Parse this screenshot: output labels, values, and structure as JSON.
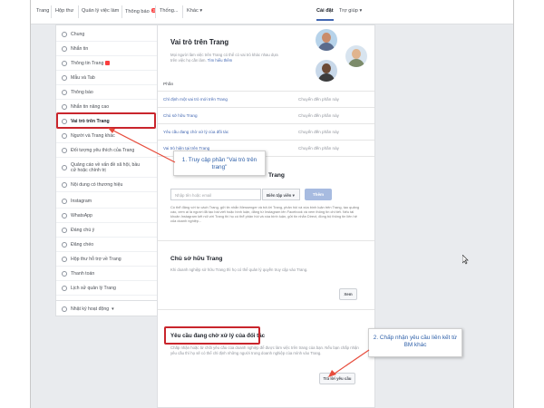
{
  "topbar": {
    "tabs": [
      "Trang",
      "Hộp thư",
      "Quản lý việc làm",
      "Thông báo",
      "Thống...",
      "Khác"
    ],
    "notif_badge": "3",
    "right_tabs": [
      "Cài đặt",
      "Trợ giúp"
    ]
  },
  "sidebar": {
    "items": [
      "Chung",
      "Nhắn tin",
      "Thông tin Trang",
      "Mẫu và Tab",
      "Thông báo",
      "Nhắn tin nâng cao",
      "Vai trò trên Trang",
      "Người và Trang khác",
      "Đối tượng yêu thích của Trang",
      "Quảng cáo về vấn đề xã hội, bầu cử hoặc chính trị",
      "Nội dung có thương hiệu",
      "Instagram",
      "WhatsApp",
      "Đáng chú ý",
      "Đăng chéo",
      "Hộp thư hỗ trợ về Trang",
      "Thanh toán",
      "Lịch sử quản lý Trang"
    ],
    "activity_log": "Nhật ký hoạt động"
  },
  "main": {
    "title": "Vai trò trên Trang",
    "desc": "Mọi người làm việc trên Trang có thể có vai trò khác nhau dựa trên việc họ cần làm.",
    "learn_more": "Tìm hiểu thêm",
    "section_label": "Phần",
    "rows": [
      {
        "label": "Chỉ định một vai trò mới trên Trang",
        "action": "Chuyển đến phần này"
      },
      {
        "label": "Chủ sở hữu Trang",
        "action": "Chuyển đến phần này"
      },
      {
        "label": "Yêu cầu đang chờ xử lý của đối tác",
        "action": "Chuyển đến phần này"
      },
      {
        "label": "Vai trò hiện tại trên Trang",
        "action": "Chuyển đến phần này"
      }
    ],
    "assign_title_partial": "Trang",
    "email_placeholder": "Nhập tên hoặc email",
    "role_select": "Biên tập viên",
    "add_button": "Thêm",
    "assign_desc": "Có thể đăng với tư cách Trang, gửi tin nhắn Messenger và trả lời Trang, phản hồi và xóa bình luận trên Trang, tạo quảng cáo, xem ai là người đã tạo bài viết hoặc bình luận, đăng từ Instagram lên Facebook và xem thông tin chi tiết. Nếu tài khoản Instagram kết nối với Trang thì họ có thể phản hồi và xóa bình luận, gửi tin nhắn Direct, đồng bộ thông tin liên hệ của doanh nghiệp...",
    "owner_title": "Chủ sở hữu Trang",
    "owner_desc": "Khi doanh nghiệp sở hữu Trang thì họ có thể quản lý quyền truy cập vào Trang.",
    "owner_button": "Xem",
    "pending_title": "Yêu cầu đang chờ xử lý của đối tác",
    "pending_desc": "Chấp nhận hoặc từ chối yêu cầu của doanh nghiệp để được làm việc trên trang của bạn. Nếu bạn chấp nhận yêu cầu thì họ sẽ có thể chỉ định những người trong doanh nghiệp của mình vào Trang.",
    "respond_button": "Trả lời yêu cầu"
  },
  "callouts": {
    "step1": "1. Truy cập phần \"Vai trò trên trang\"",
    "step2": "2. Chấp nhận yêu cầu liên kết từ BM khác"
  },
  "colors": {
    "accent": "#4267b2",
    "highlight": "#c9252c",
    "callout_text": "#2d5fa8",
    "background": "#e9ebee"
  }
}
